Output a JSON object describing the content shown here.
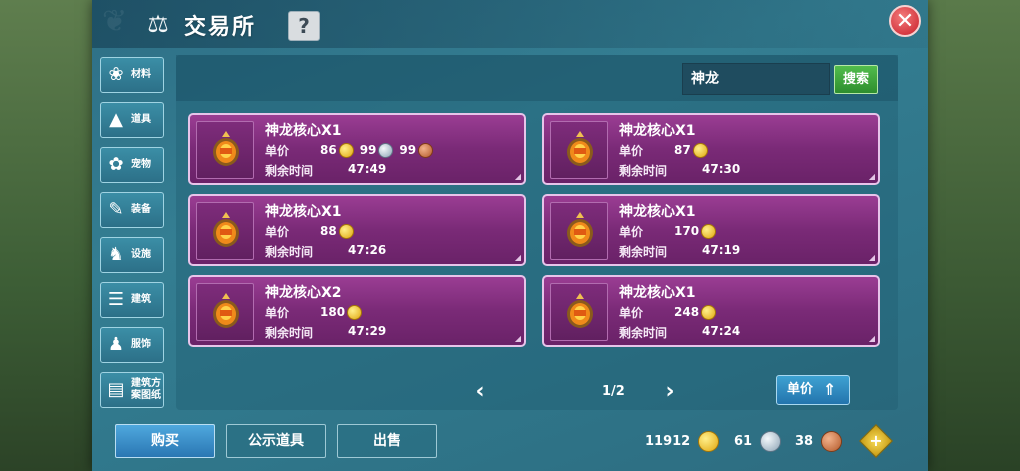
{
  "window": {
    "title": "交易所",
    "help_label": "?",
    "close_label": "✕"
  },
  "sidebar": {
    "items": [
      {
        "label": "材料",
        "icon": "materials-icon"
      },
      {
        "label": "道具",
        "icon": "props-icon"
      },
      {
        "label": "宠物",
        "icon": "pet-paw-icon"
      },
      {
        "label": "装备",
        "icon": "equipment-icon"
      },
      {
        "label": "设施",
        "icon": "facility-icon"
      },
      {
        "label": "建筑",
        "icon": "building-icon"
      },
      {
        "label": "服饰",
        "icon": "clothing-icon"
      },
      {
        "label": "建筑方案图纸",
        "icon": "blueprint-icon"
      }
    ]
  },
  "search": {
    "value": "神龙",
    "button_label": "搜索"
  },
  "listings": [
    {
      "name": "神龙核心X1",
      "price_label": "单价",
      "prices": [
        {
          "value": "86",
          "coin": "gold"
        },
        {
          "value": "99",
          "coin": "silver"
        },
        {
          "value": "99",
          "coin": "bronze"
        }
      ],
      "time_label": "剩余时间",
      "time": "47:49"
    },
    {
      "name": "神龙核心X1",
      "price_label": "单价",
      "prices": [
        {
          "value": "87",
          "coin": "gold"
        }
      ],
      "time_label": "剩余时间",
      "time": "47:30"
    },
    {
      "name": "神龙核心X1",
      "price_label": "单价",
      "prices": [
        {
          "value": "88",
          "coin": "gold"
        }
      ],
      "time_label": "剩余时间",
      "time": "47:26"
    },
    {
      "name": "神龙核心X1",
      "price_label": "单价",
      "prices": [
        {
          "value": "170",
          "coin": "gold"
        }
      ],
      "time_label": "剩余时间",
      "time": "47:19"
    },
    {
      "name": "神龙核心X2",
      "price_label": "单价",
      "prices": [
        {
          "value": "180",
          "coin": "gold"
        }
      ],
      "time_label": "剩余时间",
      "time": "47:29"
    },
    {
      "name": "神龙核心X1",
      "price_label": "单价",
      "prices": [
        {
          "value": "248",
          "coin": "gold"
        }
      ],
      "time_label": "剩余时间",
      "time": "47:24"
    }
  ],
  "pagination": {
    "prev": "‹",
    "page": "1/2",
    "next": "›"
  },
  "sort": {
    "label": "单价"
  },
  "bottom": {
    "buy_label": "购买",
    "public_label": "公示道具",
    "sell_label": "出售",
    "currency": [
      {
        "value": "11912",
        "coin": "gold"
      },
      {
        "value": "61",
        "coin": "silver"
      },
      {
        "value": "38",
        "coin": "bronze"
      }
    ],
    "add_label": "+"
  },
  "colors": {
    "panel": "#347e92",
    "card": "#8a3385",
    "search_button": "#3fa53c",
    "gold_coin": "#f2c23a",
    "silver_coin": "#b9c8d4",
    "bronze_coin": "#c9713c"
  }
}
